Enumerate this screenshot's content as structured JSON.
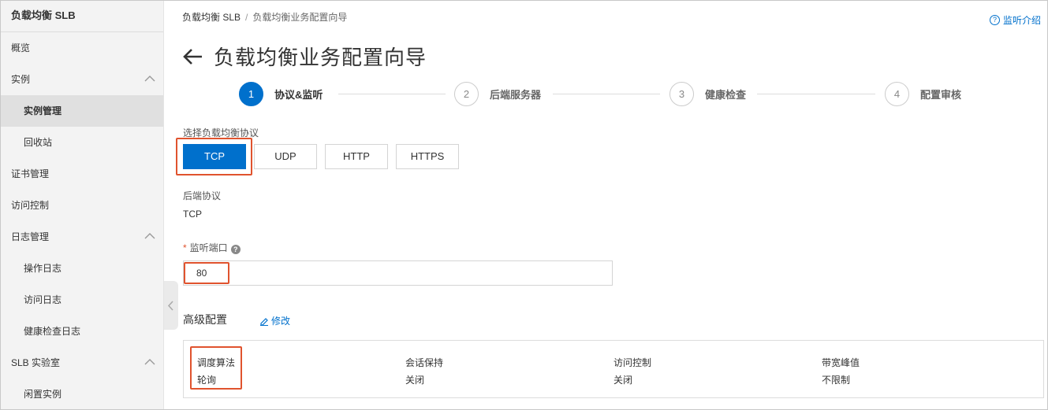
{
  "sidebar": {
    "title": "负载均衡 SLB",
    "items": [
      {
        "label": "概览"
      },
      {
        "label": "实例"
      },
      {
        "label": "实例管理"
      },
      {
        "label": "回收站"
      },
      {
        "label": "证书管理"
      },
      {
        "label": "访问控制"
      },
      {
        "label": "日志管理"
      },
      {
        "label": "操作日志"
      },
      {
        "label": "访问日志"
      },
      {
        "label": "健康检查日志"
      },
      {
        "label": "SLB 实验室"
      },
      {
        "label": "闲置实例"
      }
    ]
  },
  "breadcrumb": {
    "root": "负载均衡 SLB",
    "separator": "/",
    "current": "负载均衡业务配置向导"
  },
  "help_link": {
    "icon": "?",
    "label": "监听介绍"
  },
  "page_title": "负载均衡业务配置向导",
  "steps": [
    {
      "num": "1",
      "label": "协议&监听",
      "state": "active"
    },
    {
      "num": "2",
      "label": "后端服务器",
      "state": "pending"
    },
    {
      "num": "3",
      "label": "健康检查",
      "state": "pending"
    },
    {
      "num": "4",
      "label": "配置审核",
      "state": "pending"
    }
  ],
  "protocol": {
    "label": "选择负载均衡协议",
    "options": [
      "TCP",
      "UDP",
      "HTTP",
      "HTTPS"
    ],
    "selected": "TCP"
  },
  "backend_protocol": {
    "label": "后端协议",
    "value": "TCP"
  },
  "listen_port": {
    "required_mark": "*",
    "label": "监听端口",
    "help": "?",
    "value": "80"
  },
  "advanced": {
    "title": "高级配置",
    "edit_label": "修改",
    "fields": [
      {
        "key": "调度算法",
        "value": "轮询"
      },
      {
        "key": "会话保持",
        "value": "关闭"
      },
      {
        "key": "访问控制",
        "value": "关闭"
      },
      {
        "key": "带宽峰值",
        "value": "不限制"
      }
    ]
  },
  "colors": {
    "accent": "#0070cc",
    "highlight": "#e0532e"
  }
}
